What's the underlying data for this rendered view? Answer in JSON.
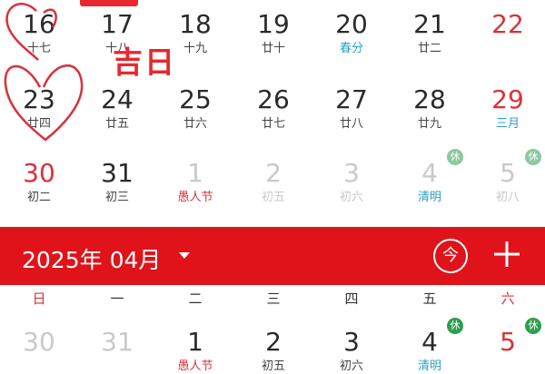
{
  "colors": {
    "accent": "#e0131a",
    "weekend": "#d8323a",
    "solar_term": "#2aa0c4",
    "rest": "#2e9e4f",
    "faded": "#c9c9c9"
  },
  "march": {
    "rows": [
      [
        {
          "day": "16",
          "lunar": "十七",
          "style": "normal",
          "lunar_style": "normal"
        },
        {
          "day": "17",
          "lunar": "十八",
          "style": "normal",
          "lunar_style": "normal"
        },
        {
          "day": "18",
          "lunar": "十九",
          "style": "normal",
          "lunar_style": "normal"
        },
        {
          "day": "19",
          "lunar": "廿十",
          "style": "normal",
          "lunar_style": "normal"
        },
        {
          "day": "20",
          "lunar": "春分",
          "style": "normal",
          "lunar_style": "term"
        },
        {
          "day": "21",
          "lunar": "廿二",
          "style": "normal",
          "lunar_style": "normal"
        },
        {
          "day": "22",
          "lunar": "",
          "style": "red",
          "lunar_style": "normal"
        }
      ],
      [
        {
          "day": "23",
          "lunar": "廿四",
          "style": "normal",
          "lunar_style": "normal"
        },
        {
          "day": "24",
          "lunar": "廿五",
          "style": "normal",
          "lunar_style": "normal"
        },
        {
          "day": "25",
          "lunar": "廿六",
          "style": "normal",
          "lunar_style": "normal"
        },
        {
          "day": "26",
          "lunar": "廿七",
          "style": "normal",
          "lunar_style": "normal"
        },
        {
          "day": "27",
          "lunar": "廿八",
          "style": "normal",
          "lunar_style": "normal"
        },
        {
          "day": "28",
          "lunar": "廿九",
          "style": "normal",
          "lunar_style": "normal"
        },
        {
          "day": "29",
          "lunar": "三月",
          "style": "red",
          "lunar_style": "term"
        }
      ],
      [
        {
          "day": "30",
          "lunar": "初二",
          "style": "red",
          "lunar_style": "normal"
        },
        {
          "day": "31",
          "lunar": "初三",
          "style": "normal",
          "lunar_style": "normal"
        },
        {
          "day": "1",
          "lunar": "愚人节",
          "style": "faded",
          "lunar_style": "holiday"
        },
        {
          "day": "2",
          "lunar": "初五",
          "style": "faded",
          "lunar_style": "normal"
        },
        {
          "day": "3",
          "lunar": "初六",
          "style": "faded",
          "lunar_style": "normal"
        },
        {
          "day": "4",
          "lunar": "清明",
          "style": "faded",
          "lunar_style": "term",
          "rest": "休"
        },
        {
          "day": "5",
          "lunar": "初八",
          "style": "faded",
          "lunar_style": "normal",
          "rest": "休"
        }
      ]
    ]
  },
  "overlay": {
    "jiri": "吉日"
  },
  "header": {
    "title": "2025年 04月",
    "today_label": "今"
  },
  "weekdays": [
    "日",
    "一",
    "二",
    "三",
    "四",
    "五",
    "六"
  ],
  "april": {
    "row": [
      {
        "day": "30",
        "lunar": "",
        "style": "faded",
        "lunar_style": "normal"
      },
      {
        "day": "31",
        "lunar": "",
        "style": "faded",
        "lunar_style": "normal"
      },
      {
        "day": "1",
        "lunar": "愚人节",
        "style": "normal",
        "lunar_style": "holiday"
      },
      {
        "day": "2",
        "lunar": "初五",
        "style": "normal",
        "lunar_style": "normal"
      },
      {
        "day": "3",
        "lunar": "初六",
        "style": "normal",
        "lunar_style": "normal"
      },
      {
        "day": "4",
        "lunar": "清明",
        "style": "normal",
        "lunar_style": "term",
        "rest": "休"
      },
      {
        "day": "5",
        "lunar": "",
        "style": "red",
        "lunar_style": "normal",
        "rest": "休"
      }
    ]
  }
}
